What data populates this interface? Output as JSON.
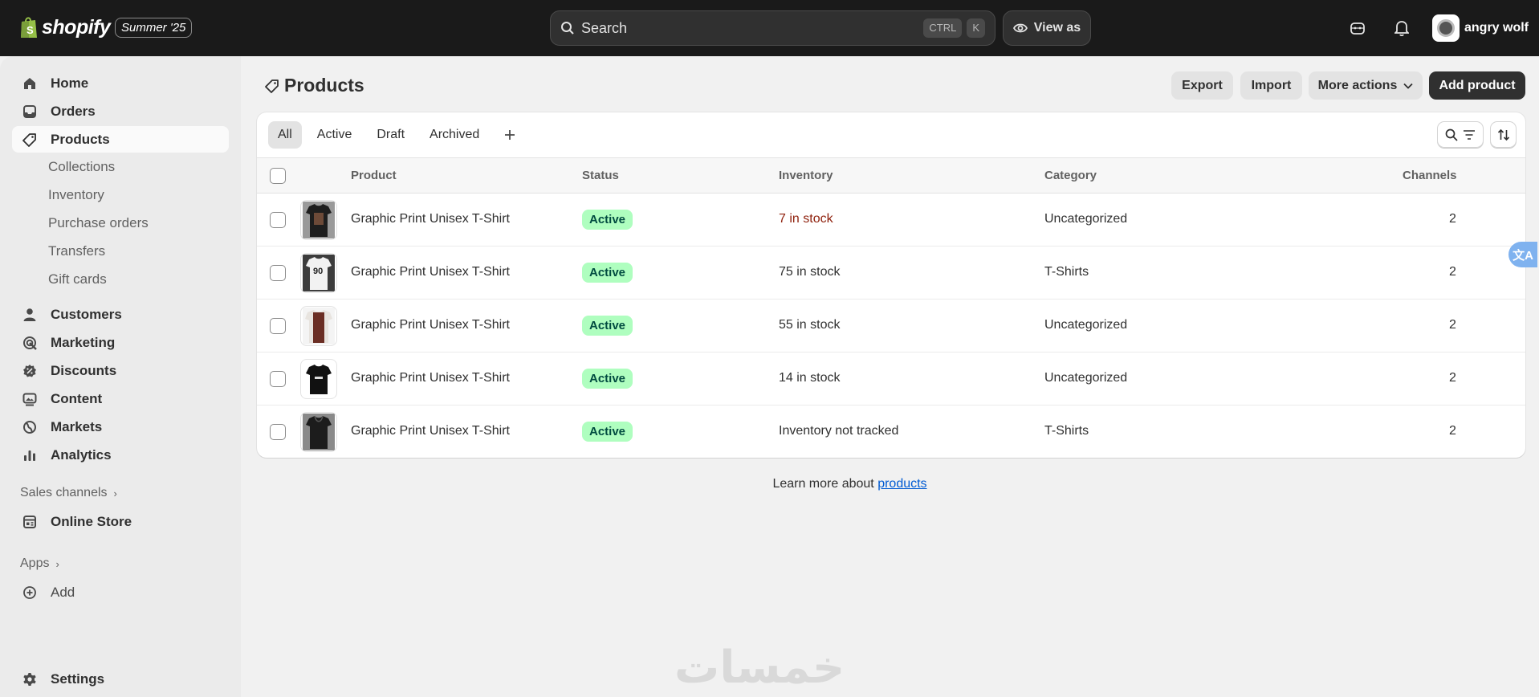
{
  "topbar": {
    "logo_text": "shopify",
    "edition": "Summer '25",
    "search_placeholder": "Search",
    "shortcut_keys": [
      "CTRL",
      "K"
    ],
    "view_as": "View as",
    "user_name": "angry wolf"
  },
  "sidebar": {
    "main_items": [
      {
        "label": "Home",
        "icon": "home-icon"
      },
      {
        "label": "Orders",
        "icon": "inbox-icon"
      },
      {
        "label": "Products",
        "icon": "tag-icon",
        "active": true
      }
    ],
    "product_subitems": [
      "Collections",
      "Inventory",
      "Purchase orders",
      "Transfers",
      "Gift cards"
    ],
    "secondary_items": [
      {
        "label": "Customers",
        "icon": "person-icon"
      },
      {
        "label": "Marketing",
        "icon": "target-icon"
      },
      {
        "label": "Discounts",
        "icon": "discount-icon"
      },
      {
        "label": "Content",
        "icon": "image-icon"
      },
      {
        "label": "Markets",
        "icon": "globe-icon"
      },
      {
        "label": "Analytics",
        "icon": "bar-chart-icon"
      }
    ],
    "sales_channels_label": "Sales channels",
    "online_store": "Online Store",
    "apps_label": "Apps",
    "add_label": "Add",
    "settings": "Settings"
  },
  "page": {
    "title": "Products",
    "export": "Export",
    "import": "Import",
    "more_actions": "More actions",
    "add_product": "Add product"
  },
  "tabs": [
    "All",
    "Active",
    "Draft",
    "Archived"
  ],
  "table": {
    "headers": {
      "product": "Product",
      "status": "Status",
      "inventory": "Inventory",
      "category": "Category",
      "channels": "Channels"
    },
    "rows": [
      {
        "product": "Graphic Print Unisex T-Shirt",
        "status": "Active",
        "inventory": "7 in stock",
        "category": "Uncategorized",
        "channels": "2",
        "thumb_color": "#2a2a2a"
      },
      {
        "product": "Graphic Print Unisex T-Shirt",
        "status": "Active",
        "inventory": "75 in stock",
        "category": "T-Shirts",
        "channels": "2",
        "thumb_color": "#3c3c3c",
        "thumb_text": "90"
      },
      {
        "product": "Graphic Print Unisex T-Shirt",
        "status": "Active",
        "inventory": "55 in stock",
        "category": "Uncategorized",
        "channels": "2",
        "thumb_color": "#6b2e24"
      },
      {
        "product": "Graphic Print Unisex T-Shirt",
        "status": "Active",
        "inventory": "14 in stock",
        "category": "Uncategorized",
        "channels": "2",
        "thumb_color": "#111111"
      },
      {
        "product": "Graphic Print Unisex T-Shirt",
        "status": "Active",
        "inventory": "Inventory not tracked",
        "category": "T-Shirts",
        "channels": "2",
        "thumb_color": "#1c1c1c"
      }
    ]
  },
  "footer": {
    "learn_prefix": "Learn more about ",
    "learn_link": "products"
  },
  "translate_fab": "文A",
  "watermark": "خمسات",
  "colors": {
    "topbar": "#1a1a1a",
    "badge_bg": "#affebf",
    "badge_text": "#014b40",
    "low_stock": "#8e1f0b",
    "link": "#005bd3"
  }
}
